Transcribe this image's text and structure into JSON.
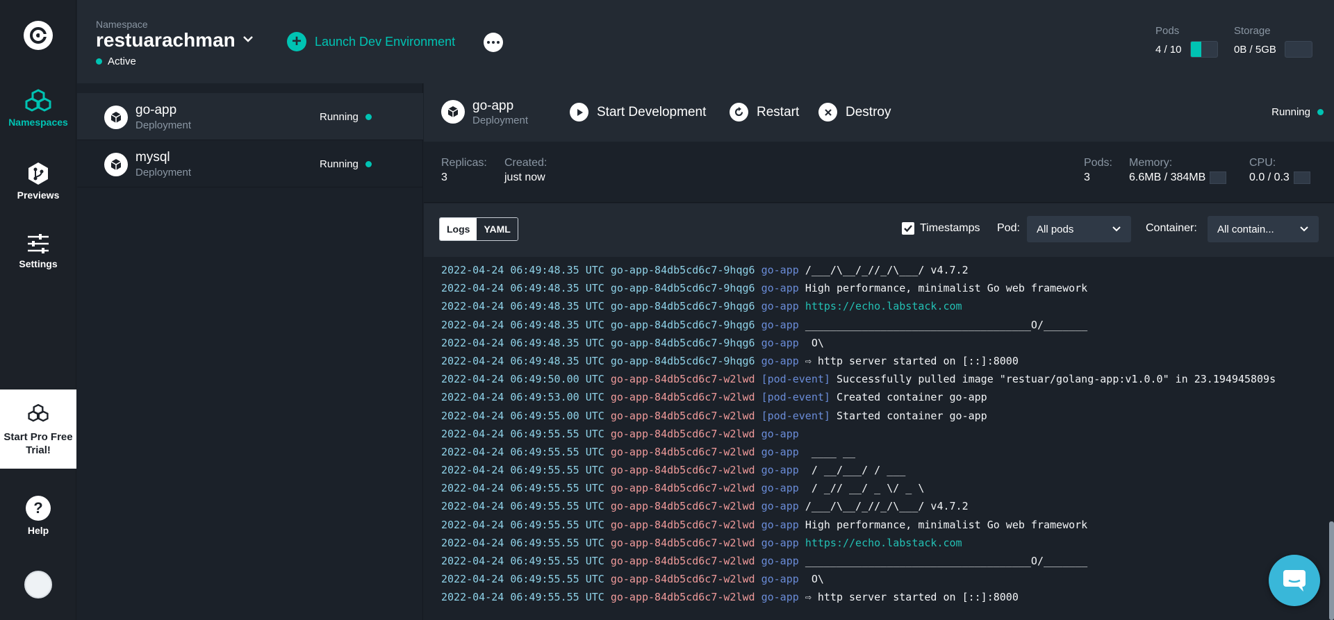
{
  "nav": {
    "items": [
      {
        "label": "Namespaces",
        "icon": "namespaces-icon"
      },
      {
        "label": "Previews",
        "icon": "previews-icon"
      },
      {
        "label": "Settings",
        "icon": "settings-icon"
      }
    ],
    "promo": "Start Pro Free Trial!",
    "help": "Help"
  },
  "header": {
    "namespace_label": "Namespace",
    "namespace_name": "restuarachman",
    "namespace_status": "Active",
    "launch_label": "Launch Dev Environment",
    "pods_label": "Pods",
    "pods_value": "4 / 10",
    "pods_fraction": 0.4,
    "storage_label": "Storage",
    "storage_value": "0B / 5GB",
    "storage_fraction": 0
  },
  "list": [
    {
      "name": "go-app",
      "kind": "Deployment",
      "status": "Running"
    },
    {
      "name": "mysql",
      "kind": "Deployment",
      "status": "Running"
    }
  ],
  "detail": {
    "name": "go-app",
    "kind": "Deployment",
    "actions": [
      "Start Development",
      "Restart",
      "Destroy"
    ],
    "status": "Running",
    "replicas_label": "Replicas:",
    "replicas_value": "3",
    "created_label": "Created:",
    "created_value": "just now",
    "pods_label": "Pods:",
    "pods_value": "3",
    "memory_label": "Memory:",
    "memory_value": "6.6MB / 384MB",
    "cpu_label": "CPU:",
    "cpu_value": "0.0 / 0.3"
  },
  "logs": {
    "tab_logs": "Logs",
    "tab_yaml": "YAML",
    "timestamps_label": "Timestamps",
    "pod_label": "Pod:",
    "pod_value": "All pods",
    "container_label": "Container:",
    "container_value": "All contain...",
    "lines": [
      {
        "t": "2022-04-24 06:49:48.35 UTC",
        "p": "go-app-84db5cd6c7-9hqg6",
        "c": "go-app",
        "m": "/___/\\__/_//_/\\___/ v4.7.2"
      },
      {
        "t": "2022-04-24 06:49:48.35 UTC",
        "p": "go-app-84db5cd6c7-9hqg6",
        "c": "go-app",
        "m": "High performance, minimalist Go web framework"
      },
      {
        "t": "2022-04-24 06:49:48.35 UTC",
        "p": "go-app-84db5cd6c7-9hqg6",
        "c": "go-app",
        "m": "https://echo.labstack.com"
      },
      {
        "t": "2022-04-24 06:49:48.35 UTC",
        "p": "go-app-84db5cd6c7-9hqg6",
        "c": "go-app",
        "m": "____________________________________O/_______"
      },
      {
        "t": "2022-04-24 06:49:48.35 UTC",
        "p": "go-app-84db5cd6c7-9hqg6",
        "c": "go-app",
        "m": " O\\"
      },
      {
        "t": "2022-04-24 06:49:48.35 UTC",
        "p": "go-app-84db5cd6c7-9hqg6",
        "c": "go-app",
        "m": "⇨ http server started on [::]:8000"
      },
      {
        "t": "2022-04-24 06:49:50.00 UTC",
        "p": "go-app-84db5cd6c7-w2lwd",
        "c": "[pod-event]",
        "m": "Successfully pulled image \"restuar/golang-app:v1.0.0\" in 23.194945809s"
      },
      {
        "t": "2022-04-24 06:49:53.00 UTC",
        "p": "go-app-84db5cd6c7-w2lwd",
        "c": "[pod-event]",
        "m": "Created container go-app"
      },
      {
        "t": "2022-04-24 06:49:55.00 UTC",
        "p": "go-app-84db5cd6c7-w2lwd",
        "c": "[pod-event]",
        "m": "Started container go-app"
      },
      {
        "t": "2022-04-24 06:49:55.55 UTC",
        "p": "go-app-84db5cd6c7-w2lwd",
        "c": "go-app",
        "m": ""
      },
      {
        "t": "2022-04-24 06:49:55.55 UTC",
        "p": "go-app-84db5cd6c7-w2lwd",
        "c": "go-app",
        "m": " ____ __"
      },
      {
        "t": "2022-04-24 06:49:55.55 UTC",
        "p": "go-app-84db5cd6c7-w2lwd",
        "c": "go-app",
        "m": " / __/___/ / ___"
      },
      {
        "t": "2022-04-24 06:49:55.55 UTC",
        "p": "go-app-84db5cd6c7-w2lwd",
        "c": "go-app",
        "m": " / _// __/ _ \\/ _ \\"
      },
      {
        "t": "2022-04-24 06:49:55.55 UTC",
        "p": "go-app-84db5cd6c7-w2lwd",
        "c": "go-app",
        "m": "/___/\\__/_//_/\\___/ v4.7.2"
      },
      {
        "t": "2022-04-24 06:49:55.55 UTC",
        "p": "go-app-84db5cd6c7-w2lwd",
        "c": "go-app",
        "m": "High performance, minimalist Go web framework"
      },
      {
        "t": "2022-04-24 06:49:55.55 UTC",
        "p": "go-app-84db5cd6c7-w2lwd",
        "c": "go-app",
        "m": "https://echo.labstack.com"
      },
      {
        "t": "2022-04-24 06:49:55.55 UTC",
        "p": "go-app-84db5cd6c7-w2lwd",
        "c": "go-app",
        "m": "____________________________________O/_______"
      },
      {
        "t": "2022-04-24 06:49:55.55 UTC",
        "p": "go-app-84db5cd6c7-w2lwd",
        "c": "go-app",
        "m": " O\\"
      },
      {
        "t": "2022-04-24 06:49:55.55 UTC",
        "p": "go-app-84db5cd6c7-w2lwd",
        "c": "go-app",
        "m": "⇨ http server started on [::]:8000"
      }
    ]
  },
  "colors": {
    "accent": "#00c3b3",
    "background": "#1b2129",
    "panel": "#232a33"
  }
}
